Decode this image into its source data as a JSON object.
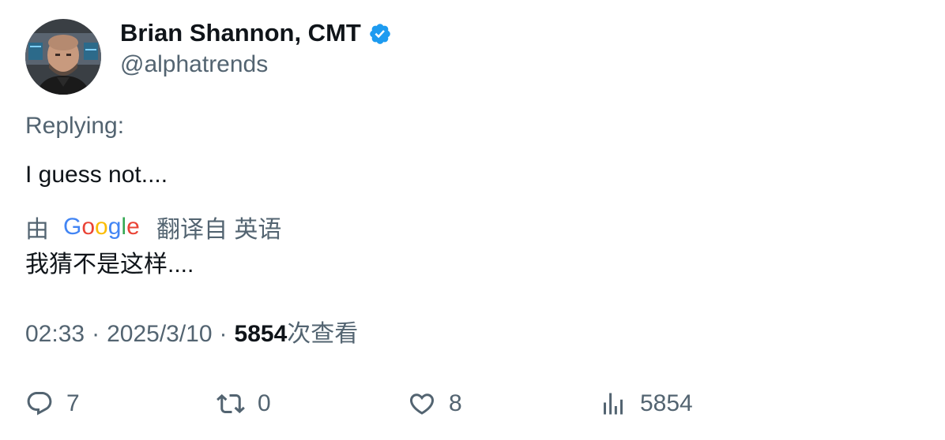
{
  "author": {
    "display_name": "Brian Shannon, CMT",
    "handle": "@alphatrends",
    "verified": true
  },
  "replying_label": "Replying:",
  "tweet_text": "I guess not....",
  "translation": {
    "by_label": "由",
    "provider": "Google",
    "from_label": "翻译自 英语",
    "translated_text": "我猜不是这样...."
  },
  "meta": {
    "time": "02:33",
    "separator": "·",
    "date": "2025/3/10",
    "views_count": "5854",
    "views_label": "次查看"
  },
  "actions": {
    "reply_count": "7",
    "retweet_count": "0",
    "like_count": "8",
    "views_count": "5854"
  },
  "colors": {
    "text_primary": "#0f1419",
    "text_secondary": "#536471",
    "verified_blue": "#1d9bf0"
  }
}
